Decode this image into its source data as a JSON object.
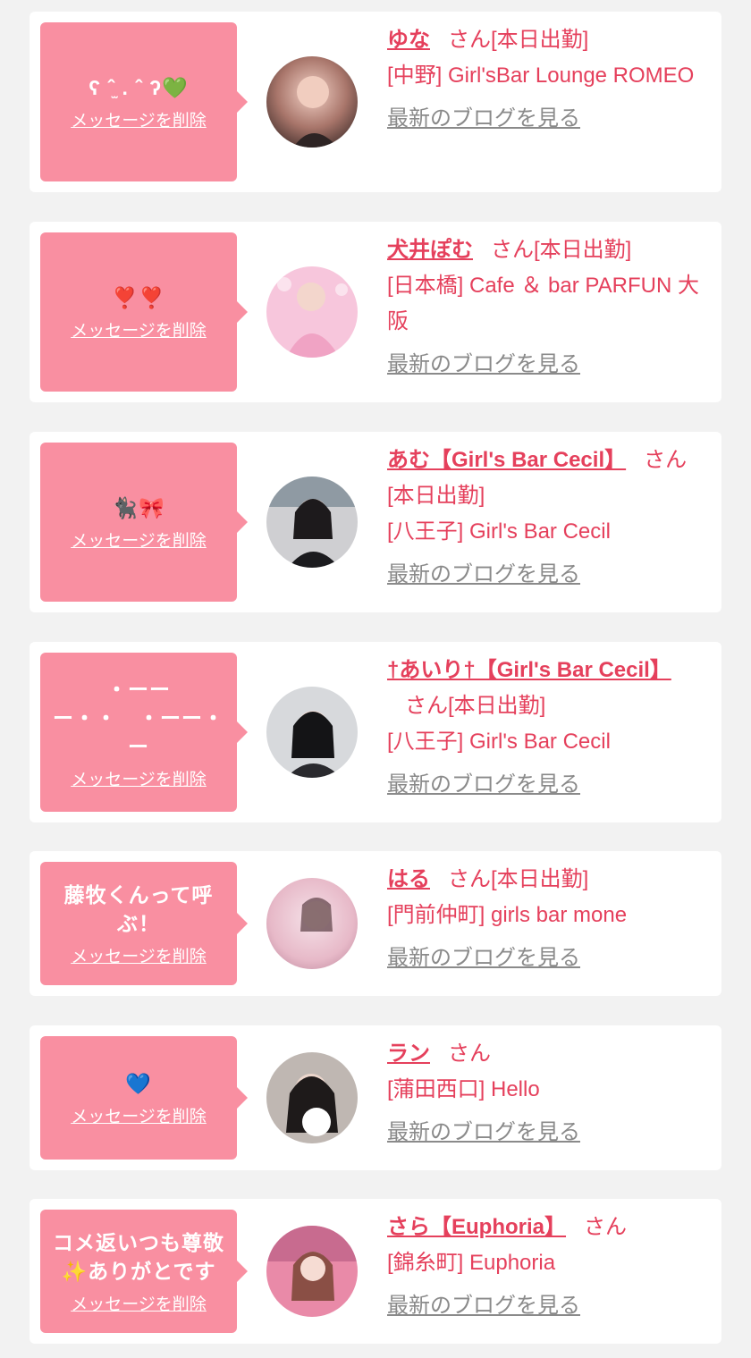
{
  "theme": {
    "bubble_color": "#f98fa1",
    "accent_color": "#e5405c",
    "muted_color": "#8a8a8a",
    "background": "#f2f2f2",
    "card_color": "#ffffff"
  },
  "delete_label": "メッセージを削除",
  "blog_label": "最新のブログを見る",
  "cards": [
    {
      "message": "ʕ ˆ̫ . ˆ ʔ💚",
      "name": "ゆな",
      "honorific": "さん[本日出勤]",
      "shop": "[中野] Girl'sBar Lounge ROMEO",
      "avatar_icon": "profile-photo"
    },
    {
      "message": "❣️❣️",
      "name": "犬井ぽむ",
      "honorific": "さん[本日出勤]",
      "shop": "[日本橋] Cafe ＆ bar PARFUN 大阪",
      "avatar_icon": "profile-photo"
    },
    {
      "message": "🐈‍⬛🎀",
      "name": "あむ【Girl's Bar Cecil】",
      "honorific": "さん[本日出勤]",
      "shop": "[八王子] Girl's Bar Cecil",
      "avatar_icon": "profile-photo"
    },
    {
      "message": "・ーー\nー・・　・ーー・\nー",
      "name": "†あいり†【Girl's Bar Cecil】",
      "honorific": "さん[本日出勤]",
      "shop": "[八王子] Girl's Bar Cecil",
      "avatar_icon": "profile-photo"
    },
    {
      "message": "藤牧くんって呼ぶ！",
      "name": "はる",
      "honorific": "さん[本日出勤]",
      "shop": "[門前仲町] girls bar mone",
      "avatar_icon": "profile-photo"
    },
    {
      "message": "💙",
      "name": "ラン",
      "honorific": "さん",
      "shop": "[蒲田西口] Hello",
      "avatar_icon": "profile-photo"
    },
    {
      "message": "コメ返いつも尊敬✨ありがとです",
      "name": "さら【Euphoria】",
      "honorific": "さん",
      "shop": "[錦糸町] Euphoria",
      "avatar_icon": "profile-photo"
    }
  ]
}
